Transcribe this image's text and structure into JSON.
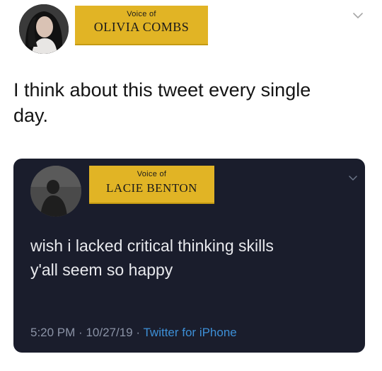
{
  "outer": {
    "nameplate_small": "Voice of",
    "nameplate_name": "OLIVIA COMBS",
    "text_line1": "I think about this tweet every single",
    "text_line2": "day."
  },
  "quoted": {
    "nameplate_small": "Voice of",
    "nameplate_name": "LACIE BENTON",
    "text_line1": "wish i lacked critical thinking skills",
    "text_line2": "y'all seem so happy",
    "time": "5:20 PM",
    "separator": "·",
    "date": "10/27/19",
    "source": "Twitter for iPhone"
  },
  "icons": {
    "outer_avatar": "profile-photo",
    "outer_menu": "chevron-down-icon",
    "quoted_avatar": "profile-photo",
    "quoted_menu": "chevron-down-icon"
  },
  "colors": {
    "nameplate": "#e1b425",
    "card_background": "#1a1d2c",
    "link": "#3d8fd6"
  }
}
